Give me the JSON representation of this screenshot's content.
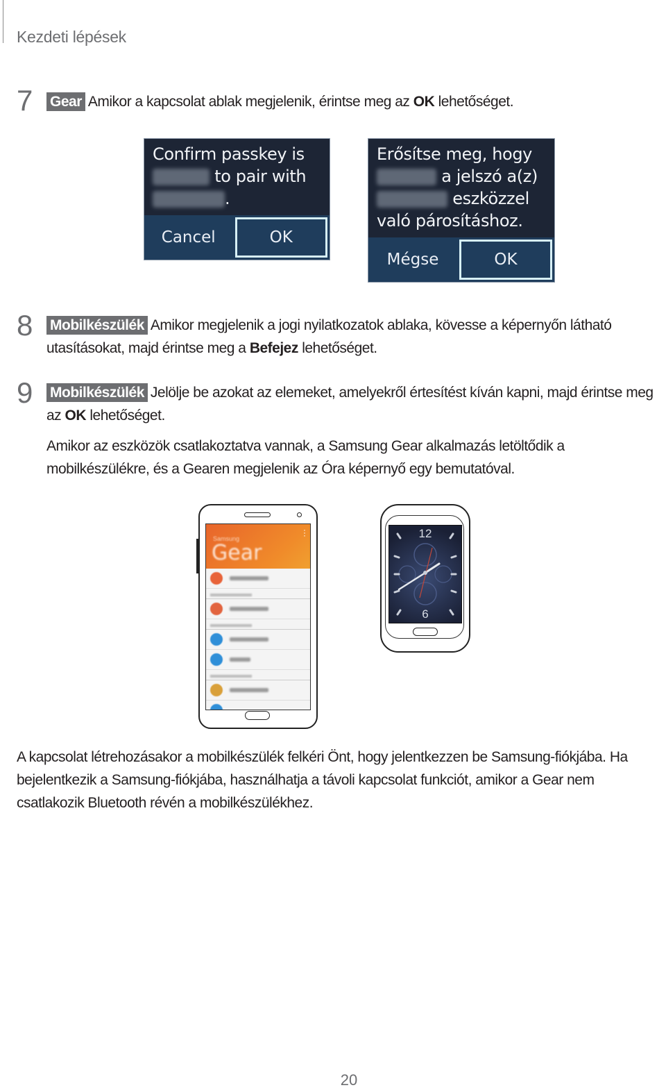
{
  "header": {
    "title": "Kezdeti lépések"
  },
  "steps": [
    {
      "number": "7",
      "badge": "Gear",
      "text_before": "Amikor a kapcsolat ablak megjelenik, érintse meg az ",
      "bold": "OK",
      "text_after": " lehetőséget."
    },
    {
      "number": "8",
      "badge": "Mobilkészülék",
      "text_before": "Amikor megjelenik a jogi nyilatkozatok ablaka, kövesse a képernyőn látható utasításokat, majd érintse meg a ",
      "bold": "Befejez",
      "text_after": " lehetőséget."
    },
    {
      "number": "9",
      "badge": "Mobilkészülék",
      "text_before": "Jelölje be azokat az elemeket, amelyekről értesítést kíván kapni, majd érintse meg az ",
      "bold": "OK",
      "text_after": " lehetőséget."
    }
  ],
  "dialogs": {
    "english": {
      "line1": "Confirm passkey is",
      "line2": "to pair with",
      "line3": ".",
      "cancel": "Cancel",
      "ok": "OK"
    },
    "hungarian": {
      "line1": "Erősítse meg, hogy",
      "line2": "a jelszó a(z)",
      "line3": "eszközzel",
      "line4": "való párosításhoz.",
      "cancel": "Mégse",
      "ok": "OK"
    }
  },
  "step9_note": "Amikor az eszközök csatlakoztatva vannak, a Samsung Gear alkalmazás letöltődik a mobilkészülékre, és a Gearen megjelenik az Óra képernyő egy bemutatóval.",
  "phone_app": {
    "title": "Gear",
    "subtitle": "Samsung"
  },
  "watch_face": {
    "top_numeral": "12",
    "bottom_numeral": "6"
  },
  "footer_paragraph": "A kapcsolat létrehozásakor a mobilkészülék felkéri Önt, hogy jelentkezzen be Samsung-fiókjába. Ha bejelentkezik a Samsung-fiókjába, használhatja a távoli kapcsolat funkciót, amikor a Gear nem csatlakozik Bluetooth révén a mobilkészülékhez.",
  "page_number": "20"
}
